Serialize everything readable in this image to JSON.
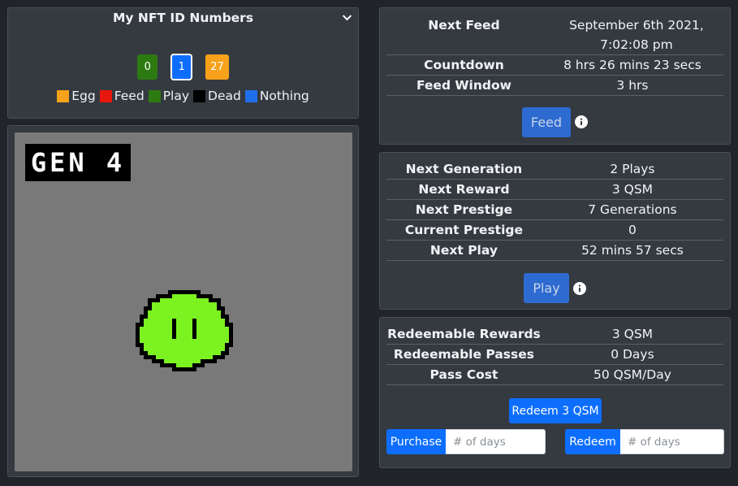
{
  "nft": {
    "title": "My NFT ID Numbers",
    "ids": [
      {
        "label": "0",
        "color": "#2d7a12",
        "selected": false
      },
      {
        "label": "1",
        "color": "#0d6efd",
        "selected": true
      },
      {
        "label": "27",
        "color": "#f7a21a",
        "selected": false
      }
    ],
    "legend": [
      {
        "label": "Egg",
        "color": "#f7a21a"
      },
      {
        "label": "Feed",
        "color": "#e8170c"
      },
      {
        "label": "Play",
        "color": "#2d7a12"
      },
      {
        "label": "Dead",
        "color": "#000000"
      },
      {
        "label": "Nothing",
        "color": "#1f6fea"
      }
    ]
  },
  "pet": {
    "generation_label": "GEN 4",
    "body_color": "#7cf221"
  },
  "feed": {
    "rows": [
      {
        "key": "Next Feed",
        "value": "September 6th 2021, 7:02:08 pm"
      },
      {
        "key": "Countdown",
        "value": "8 hrs 26 mins 23 secs"
      },
      {
        "key": "Feed Window",
        "value": "3 hrs"
      }
    ],
    "button_label": "Feed"
  },
  "play": {
    "rows": [
      {
        "key": "Next Generation",
        "value": "2 Plays"
      },
      {
        "key": "Next Reward",
        "value": "3 QSM"
      },
      {
        "key": "Next Prestige",
        "value": "7 Generations"
      },
      {
        "key": "Current Prestige",
        "value": "0"
      },
      {
        "key": "Next Play",
        "value": "52 mins 57 secs"
      }
    ],
    "button_label": "Play"
  },
  "redeem": {
    "rows": [
      {
        "key": "Redeemable Rewards",
        "value": "3 QSM"
      },
      {
        "key": "Redeemable Passes",
        "value": "0 Days"
      },
      {
        "key": "Pass Cost",
        "value": "50 QSM/Day"
      }
    ],
    "redeem_button_label": "Redeem 3 QSM",
    "purchase_label": "Purchase",
    "purchase_placeholder": "# of days",
    "redeem_days_label": "Redeem",
    "redeem_days_placeholder": "# of days"
  }
}
